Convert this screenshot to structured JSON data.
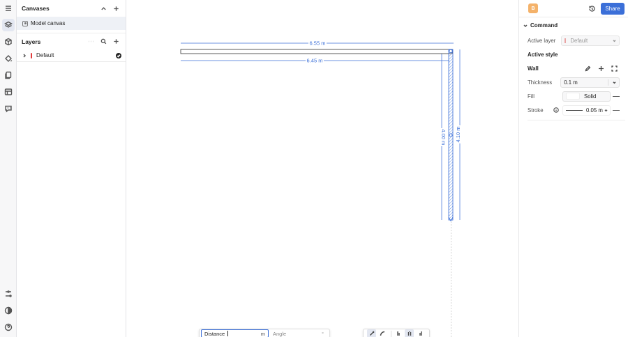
{
  "left_panel": {
    "canvases_title": "Canvases",
    "canvas_items": [
      {
        "label": "Model canvas"
      }
    ],
    "layers_title": "Layers",
    "layers": [
      {
        "label": "Default",
        "color": "#e23b3b",
        "visible": true
      }
    ]
  },
  "canvas": {
    "dimensions": {
      "top_outer": "6.55 m",
      "top_inner": "6.45 m",
      "right_inner": "4.00 m",
      "right_outer": "4.10 m"
    },
    "distance_input": {
      "label": "Distance",
      "unit": "m"
    },
    "angle_input": {
      "label": "Angle",
      "unit": "°"
    },
    "tools": [
      "line-tool",
      "arc-tool",
      "wall-left-tool",
      "wall-center-tool",
      "wall-right-tool"
    ]
  },
  "right_panel": {
    "avatar_initial": "B",
    "share_label": "Share",
    "command_title": "Command",
    "active_layer_label": "Active layer",
    "active_layer_value": "Default",
    "active_style_label": "Active style",
    "wall_label": "Wall",
    "thickness_label": "Thickness",
    "thickness_value": "0.1 m",
    "fill_label": "Fill",
    "fill_value": "Solid",
    "stroke_label": "Stroke",
    "stroke_value": "0.05 m"
  },
  "colors": {
    "accent": "#3b6fd8",
    "wall_stroke": "#3b6fd8",
    "layer_color": "#e23b3b"
  }
}
